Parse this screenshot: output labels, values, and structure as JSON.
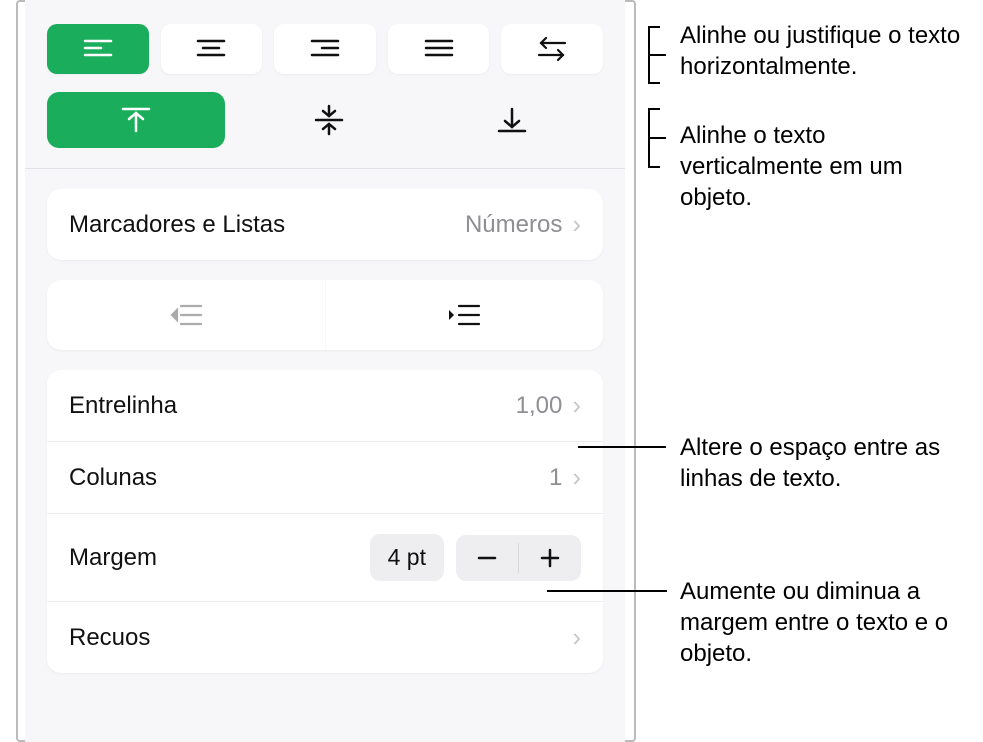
{
  "bullets": {
    "label": "Marcadores e Listas",
    "value": "Números"
  },
  "lineHeight": {
    "label": "Entrelinha",
    "value": "1,00"
  },
  "columns": {
    "label": "Colunas",
    "value": "1"
  },
  "margin": {
    "label": "Margem",
    "value": "4 pt"
  },
  "indents": {
    "label": "Recuos"
  },
  "callouts": {
    "hAlign": "Alinhe ou justifique o texto horizontalmente.",
    "vAlign": "Alinhe o texto verticalmente em um objeto.",
    "lineSpacing": "Altere o espaço entre as linhas de texto.",
    "marginAdjust": "Aumente ou diminua a margem entre o texto e o objeto."
  }
}
